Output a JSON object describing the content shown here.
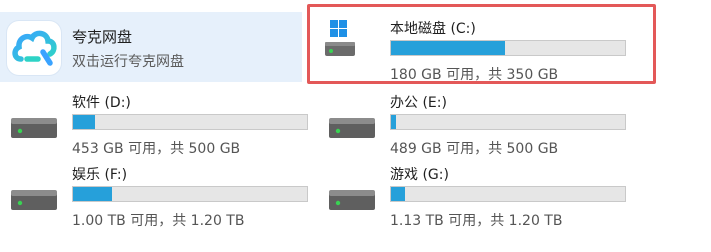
{
  "app": {
    "name": "夸克网盘",
    "subtitle": "双击运行夸克网盘",
    "icon": "quark-cloud-icon"
  },
  "drives": [
    {
      "id": "c",
      "label": "本地磁盘 (C:)",
      "info": "180 GB 可用，共 350 GB",
      "used_fraction": 0.486,
      "selected": true,
      "icon": "windows-drive-icon"
    },
    {
      "id": "d",
      "label": "软件 (D:)",
      "info": "453 GB 可用，共 500 GB",
      "used_fraction": 0.094,
      "selected": false,
      "icon": "hard-drive-icon"
    },
    {
      "id": "e",
      "label": "办公 (E:)",
      "info": "489 GB 可用，共 500 GB",
      "used_fraction": 0.022,
      "selected": false,
      "icon": "hard-drive-icon"
    },
    {
      "id": "f",
      "label": "娱乐 (F:)",
      "info": "1.00 TB 可用，共 1.20 TB",
      "used_fraction": 0.167,
      "selected": false,
      "icon": "hard-drive-icon"
    },
    {
      "id": "g",
      "label": "游戏 (G:)",
      "info": "1.13 TB 可用，共 1.20 TB",
      "used_fraction": 0.058,
      "selected": false,
      "icon": "hard-drive-icon"
    }
  ],
  "colors": {
    "bar_fill": "#26a0da",
    "bar_track": "#e6e6e6",
    "highlight_border": "#e35858",
    "app_tile_bg": "#e6f0fb"
  }
}
